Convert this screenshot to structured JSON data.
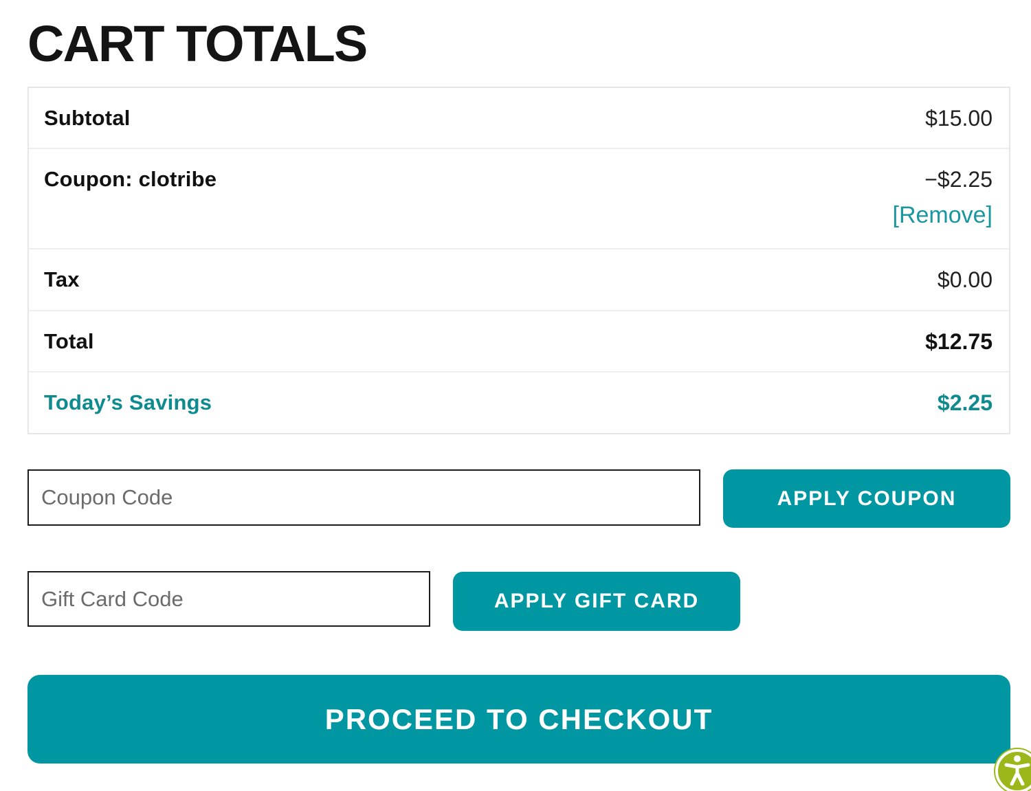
{
  "page": {
    "title": "CART TOTALS"
  },
  "totals": {
    "subtotal": {
      "label": "Subtotal",
      "value": "$15.00"
    },
    "coupon": {
      "label": "Coupon: clotribe",
      "value": "−$2.25",
      "remove": "[Remove]"
    },
    "tax": {
      "label": "Tax",
      "value": "$0.00"
    },
    "total": {
      "label": "Total",
      "value": "$12.75"
    },
    "savings": {
      "label": "Today’s Savings",
      "value": "$2.25"
    }
  },
  "coupon": {
    "placeholder": "Coupon Code",
    "value": "",
    "button": "APPLY COUPON"
  },
  "gift_card": {
    "placeholder": "Gift Card Code",
    "value": "",
    "button": "APPLY GIFT CARD"
  },
  "checkout": {
    "button": "PROCEED TO CHECKOUT"
  },
  "accessibility": {
    "icon": "accessibility-icon"
  },
  "colors": {
    "accent": "#0097a3",
    "savings": "#0f8a8f",
    "link": "#1a96a0",
    "a11y": "#9bb71a"
  }
}
